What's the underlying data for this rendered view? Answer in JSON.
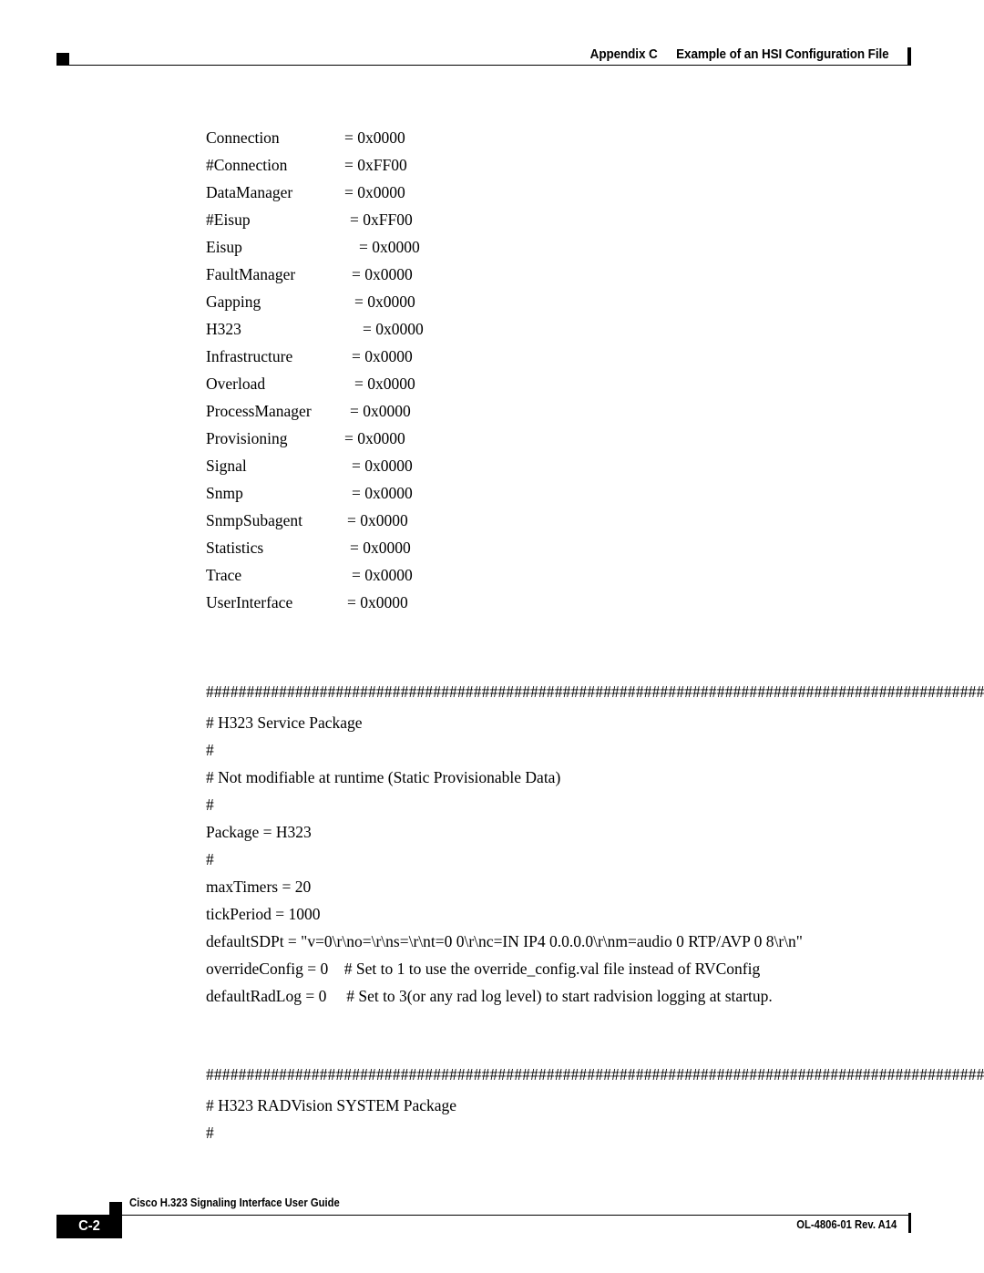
{
  "header": {
    "appendix": "Appendix C",
    "title": "Example of an HSI Configuration File"
  },
  "footer": {
    "page_number": "C-2",
    "document_title": "Cisco H.323 Signaling Interface User Guide",
    "document_id": "OL-4806-01 Rev. A14"
  },
  "config_flags": [
    {
      "key": "Connection",
      "value": "= 0x0000",
      "indent": 0
    },
    {
      "key": "#Connection",
      "value": "= 0xFF00",
      "indent": 0
    },
    {
      "key": "DataManager",
      "value": "= 0x0000",
      "indent": 0
    },
    {
      "key": "#Eisup",
      "value": "= 0xFF00",
      "indent": 3
    },
    {
      "key": "Eisup",
      "value": "= 0x0000",
      "indent": 7
    },
    {
      "key": "FaultManager",
      "value": "= 0x0000",
      "indent": 4
    },
    {
      "key": "Gapping",
      "value": "= 0x0000",
      "indent": 5
    },
    {
      "key": "H323",
      "value": "= 0x0000",
      "indent": 9
    },
    {
      "key": "Infrastructure",
      "value": "= 0x0000",
      "indent": 4
    },
    {
      "key": "Overload",
      "value": "= 0x0000",
      "indent": 5
    },
    {
      "key": "ProcessManager",
      "value": "= 0x0000",
      "indent": 4
    },
    {
      "key": "Provisioning",
      "value": "= 0x0000",
      "indent": 1
    },
    {
      "key": "Signal",
      "value": "= 0x0000",
      "indent": 5
    },
    {
      "key": "Snmp",
      "value": "= 0x0000",
      "indent": 5
    },
    {
      "key": "SnmpSubagent",
      "value": "= 0x0000",
      "indent": 2
    },
    {
      "key": "Statistics",
      "value": "= 0x0000",
      "indent": 4
    },
    {
      "key": "Trace",
      "value": "= 0x0000",
      "indent": 5
    },
    {
      "key": "UserInterface",
      "value": "= 0x0000",
      "indent": 3
    }
  ],
  "h323_service_package": {
    "hash_rule": "####################################################################################################",
    "comment_title": "# H323 Service Package",
    "hash_blank_1": "#",
    "comment_note": "# Not modifiable at runtime (Static Provisionable Data)",
    "hash_blank_2": "#",
    "package": "Package = H323",
    "hash_blank_3": "#",
    "max_timers": "maxTimers = 20",
    "tick_period": "tickPeriod = 1000",
    "default_sdpt": "defaultSDPt = \"v=0\\r\\no=\\r\\ns=\\r\\nt=0 0\\r\\nc=IN IP4 0.0.0.0\\r\\nm=audio 0 RTP/AVP 0 8\\r\\n\"",
    "override_config": "overrideConfig = 0    # Set to 1 to use the override_config.val file instead of RVConfig",
    "default_rad_log": "defaultRadLog = 0     # Set to 3(or any rad log level) to start radvision logging at startup."
  },
  "h323_radvision_package": {
    "hash_rule": "####################################################################################################",
    "comment_title": "# H323 RADVision SYSTEM Package",
    "hash_blank_1": "#"
  }
}
